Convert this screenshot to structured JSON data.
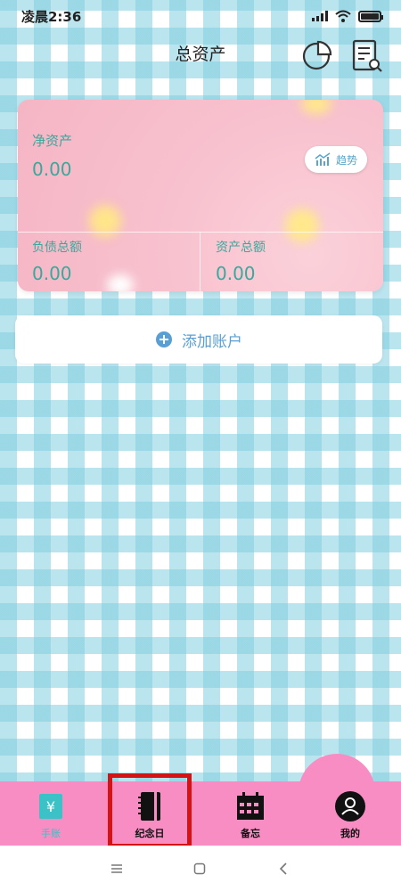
{
  "status": {
    "time": "凌晨2:36"
  },
  "header": {
    "title": "总资产"
  },
  "card": {
    "net_label": "净资产",
    "net_value": "0.00",
    "trend_label": "趋势",
    "liability_label": "负债总额",
    "liability_value": "0.00",
    "assets_label": "资产总额",
    "assets_value": "0.00"
  },
  "add_account": {
    "label": "添加账户"
  },
  "nav": {
    "items": [
      {
        "label": "手账",
        "icon": "ledger-yen-icon",
        "active": true
      },
      {
        "label": "纪念日",
        "icon": "notebook-icon",
        "active": false
      },
      {
        "label": "备忘",
        "icon": "calendar-icon",
        "active": false
      },
      {
        "label": "我的",
        "icon": "profile-icon",
        "active": false
      }
    ]
  },
  "colors": {
    "accent_teal": "#3aa89b",
    "nav_pink": "#f78dc3",
    "highlight_red": "#d41414",
    "link_blue": "#5a9fd4"
  }
}
